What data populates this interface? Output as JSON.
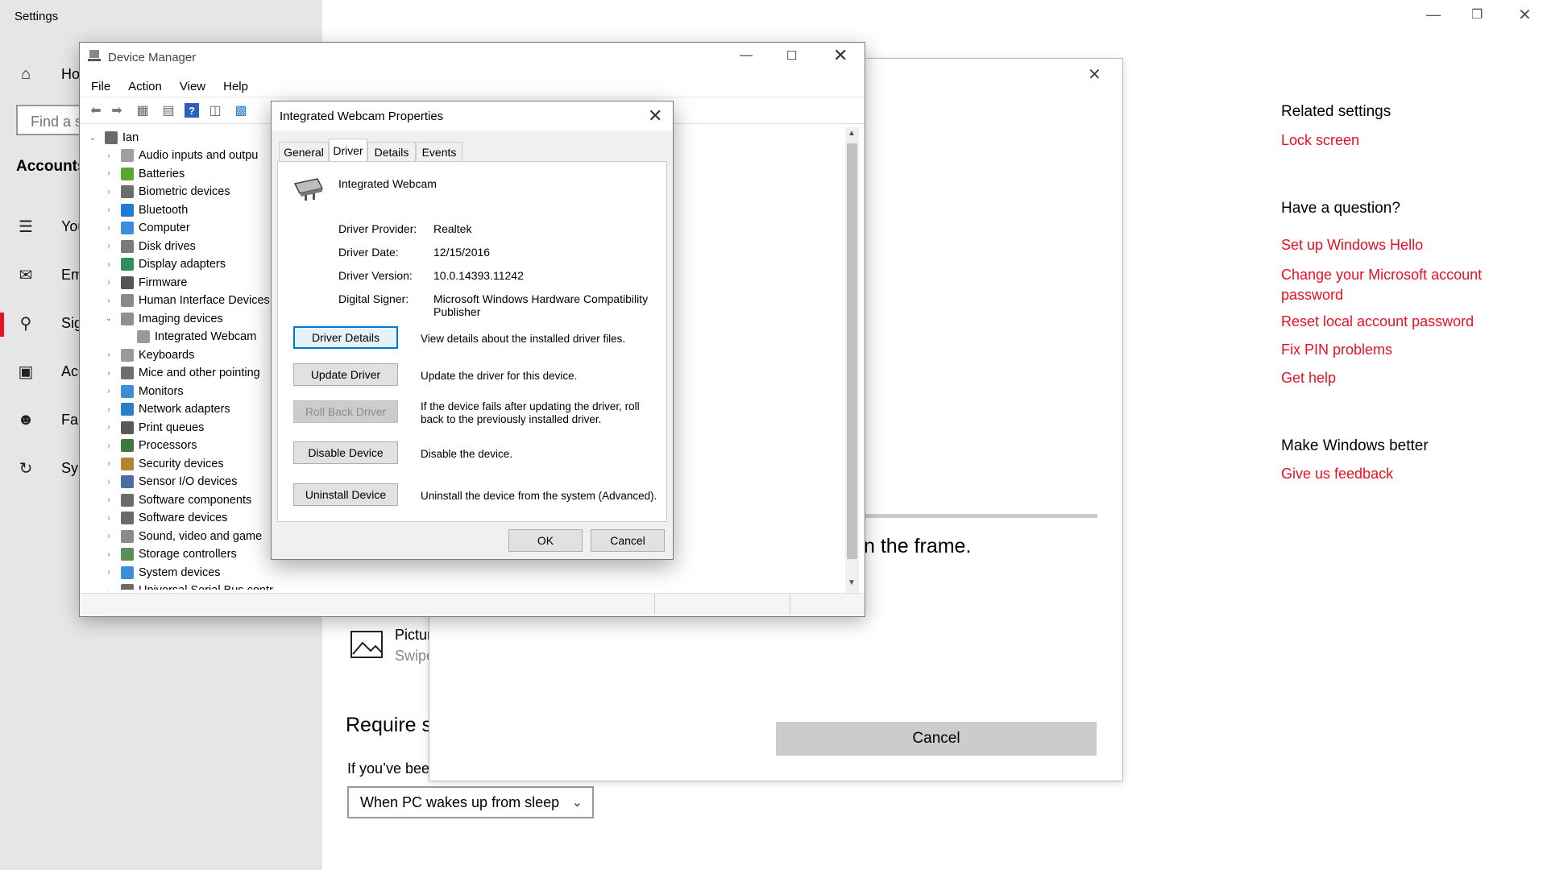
{
  "settings": {
    "title": "Settings",
    "search_placeholder": "Find a s",
    "section": "Accounts",
    "nav": [
      {
        "icon": "home-icon",
        "label": "Hom"
      },
      {
        "icon": "person-card-icon",
        "label": "Your"
      },
      {
        "icon": "email-icon",
        "label": "Emai"
      },
      {
        "icon": "key-icon",
        "label": "Sign-"
      },
      {
        "icon": "briefcase-icon",
        "label": "Acce"
      },
      {
        "icon": "family-icon",
        "label": "Fami"
      },
      {
        "icon": "sync-icon",
        "label": "Sync"
      }
    ],
    "related": {
      "heading": "Related settings",
      "links": [
        "Lock screen"
      ]
    },
    "question": {
      "heading": "Have a question?",
      "links": [
        "Set up Windows Hello",
        "Change your Microsoft account password",
        "Reset local account password",
        "Fix PIN problems",
        "Get help"
      ]
    },
    "better": {
      "heading": "Make Windows better",
      "links": [
        "Give us feedback"
      ]
    },
    "content": {
      "picture_title": "Pictur",
      "picture_sub": "Swipe",
      "require_heading": "Require si",
      "if_away": "If you’ve bee",
      "sleep_option": "When PC wakes up from sleep"
    },
    "accent": "#e81123"
  },
  "hello_dialog": {
    "frame_text": "n the frame.",
    "cancel_label": "Cancel"
  },
  "device_manager": {
    "title": "Device Manager",
    "menu": [
      "File",
      "Action",
      "View",
      "Help"
    ],
    "root": "Ian",
    "tree": [
      {
        "label": "Audio inputs and outpu",
        "color": "#9aa0a6",
        "state": "collapsed"
      },
      {
        "label": "Batteries",
        "color": "#5aa832",
        "state": "collapsed"
      },
      {
        "label": "Biometric devices",
        "color": "#6d6d6d",
        "state": "collapsed"
      },
      {
        "label": "Bluetooth",
        "color": "#1f7ad6",
        "state": "collapsed"
      },
      {
        "label": "Computer",
        "color": "#3a8fd6",
        "state": "collapsed"
      },
      {
        "label": "Disk drives",
        "color": "#7b7b7b",
        "state": "collapsed"
      },
      {
        "label": "Display adapters",
        "color": "#2f8f5b",
        "state": "collapsed"
      },
      {
        "label": "Firmware",
        "color": "#555555",
        "state": "collapsed"
      },
      {
        "label": "Human Interface Devices",
        "color": "#8a8a8a",
        "state": "collapsed"
      },
      {
        "label": "Imaging devices",
        "color": "#8f8f8f",
        "state": "expanded"
      },
      {
        "label": "Integrated Webcam",
        "color": "#9a9a9a",
        "state": "child"
      },
      {
        "label": "Keyboards",
        "color": "#9a9a9a",
        "state": "collapsed"
      },
      {
        "label": "Mice and other pointing",
        "color": "#6d6d6d",
        "state": "collapsed"
      },
      {
        "label": "Monitors",
        "color": "#3a8fd6",
        "state": "collapsed"
      },
      {
        "label": "Network adapters",
        "color": "#2a7fc8",
        "state": "collapsed"
      },
      {
        "label": "Print queues",
        "color": "#5a5a5a",
        "state": "collapsed"
      },
      {
        "label": "Processors",
        "color": "#3d7a3d",
        "state": "collapsed"
      },
      {
        "label": "Security devices",
        "color": "#b0862f",
        "state": "collapsed"
      },
      {
        "label": "Sensor I/O devices",
        "color": "#4a6fa5",
        "state": "collapsed"
      },
      {
        "label": "Software components",
        "color": "#6a6a6a",
        "state": "collapsed"
      },
      {
        "label": "Software devices",
        "color": "#6a6a6a",
        "state": "collapsed"
      },
      {
        "label": "Sound, video and game",
        "color": "#8a8a8a",
        "state": "collapsed"
      },
      {
        "label": "Storage controllers",
        "color": "#5a8f5a",
        "state": "collapsed"
      },
      {
        "label": "System devices",
        "color": "#3a8fd6",
        "state": "collapsed"
      },
      {
        "label": "Universal Serial Bus controllers",
        "color": "#6a6a6a",
        "state": "collapsed"
      }
    ]
  },
  "properties": {
    "title": "Integrated Webcam Properties",
    "tabs": [
      "General",
      "Driver",
      "Details",
      "Events"
    ],
    "active_tab": "Driver",
    "device_name": "Integrated Webcam",
    "fields": [
      {
        "key": "Driver Provider:",
        "value": "Realtek"
      },
      {
        "key": "Driver Date:",
        "value": "12/15/2016"
      },
      {
        "key": "Driver Version:",
        "value": "10.0.14393.11242"
      },
      {
        "key": "Digital Signer:",
        "value": "Microsoft Windows Hardware Compatibility Publisher"
      }
    ],
    "actions": [
      {
        "label": "Driver Details",
        "desc": "View details about the installed driver files."
      },
      {
        "label": "Update Driver",
        "desc": "Update the driver for this device."
      },
      {
        "label": "Roll Back Driver",
        "desc": "If the device fails after updating the driver, roll back to the previously installed driver."
      },
      {
        "label": "Disable Device",
        "desc": "Disable the device."
      },
      {
        "label": "Uninstall Device",
        "desc": "Uninstall the device from the system (Advanced)."
      }
    ],
    "ok_label": "OK",
    "cancel_label": "Cancel"
  }
}
